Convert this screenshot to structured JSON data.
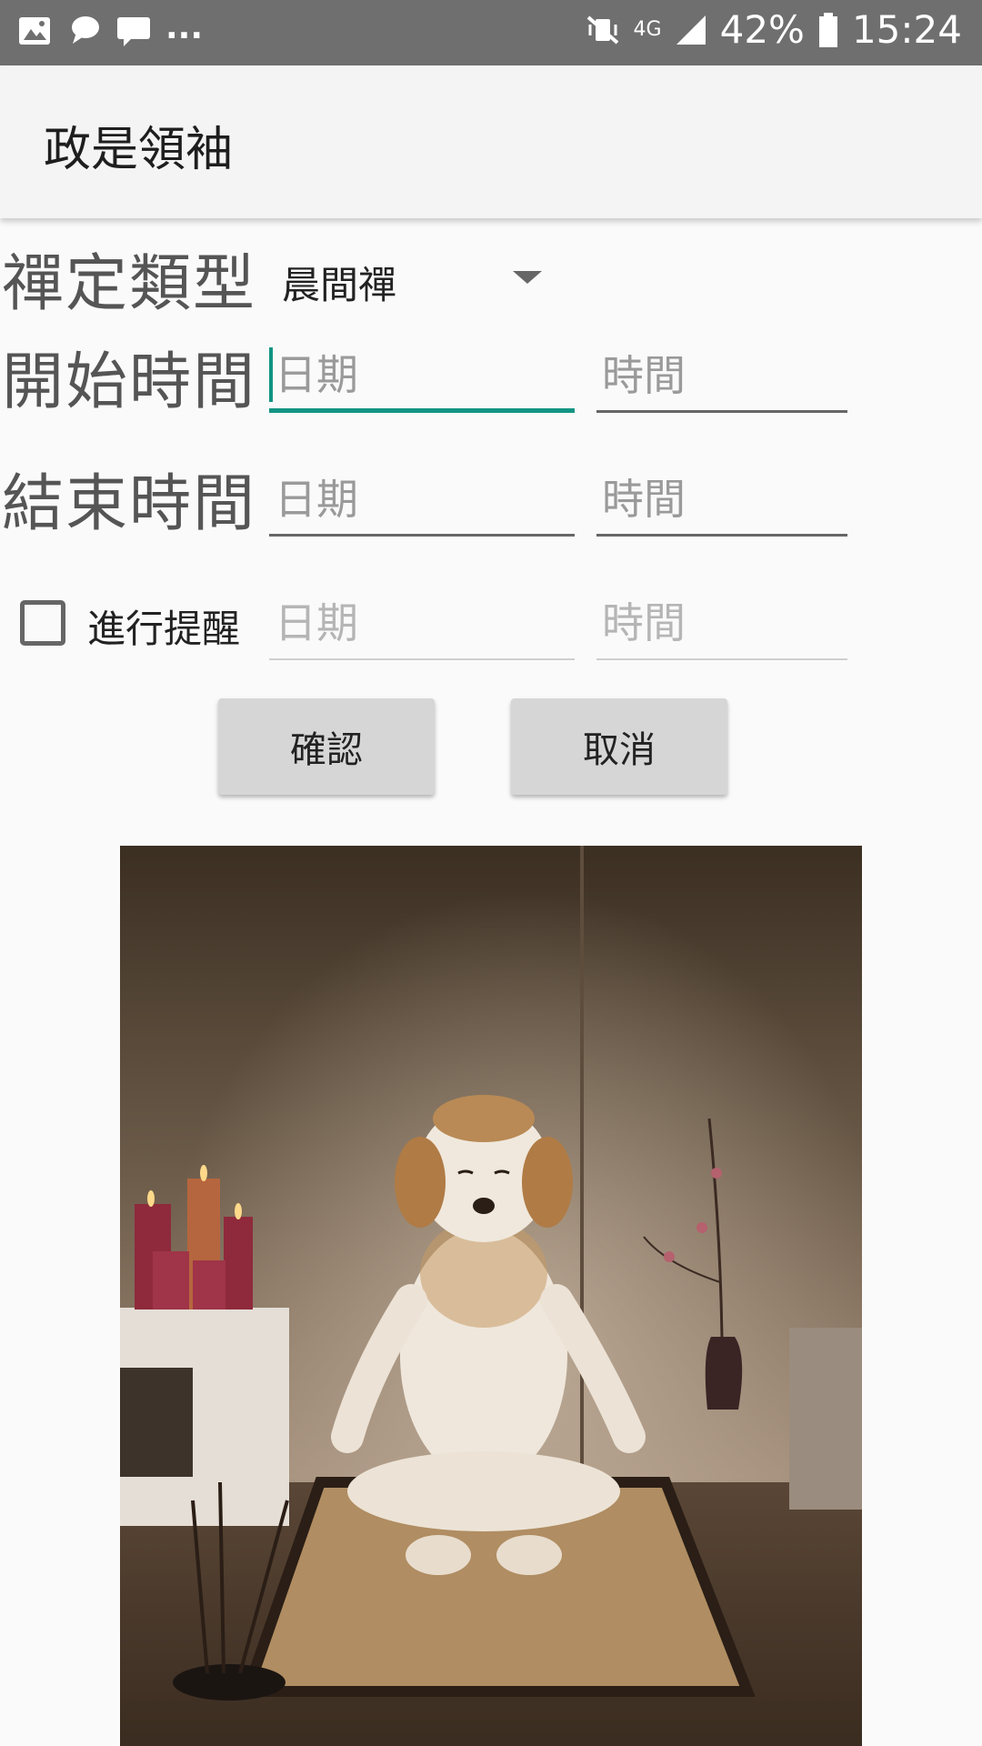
{
  "status_bar": {
    "left_icons": [
      "image-icon",
      "chat-bubble-icon",
      "message-icon"
    ],
    "more": "...",
    "battery_percent": "42%",
    "time": "15:24",
    "network": "4G"
  },
  "app_bar": {
    "title": "政是領袖"
  },
  "form": {
    "type_label": "禪定類型",
    "type_value": "晨間禪",
    "start_label": "開始時間",
    "end_label": "結束時間",
    "date_placeholder": "日期",
    "time_placeholder": "時間",
    "reminder_label": "進行提醒",
    "reminder_checked": false
  },
  "buttons": {
    "confirm": "確認",
    "cancel": "取消"
  },
  "colors": {
    "accent": "#129483",
    "status_bar": "#6f6f6f",
    "button_bg": "#d6d6d6"
  }
}
